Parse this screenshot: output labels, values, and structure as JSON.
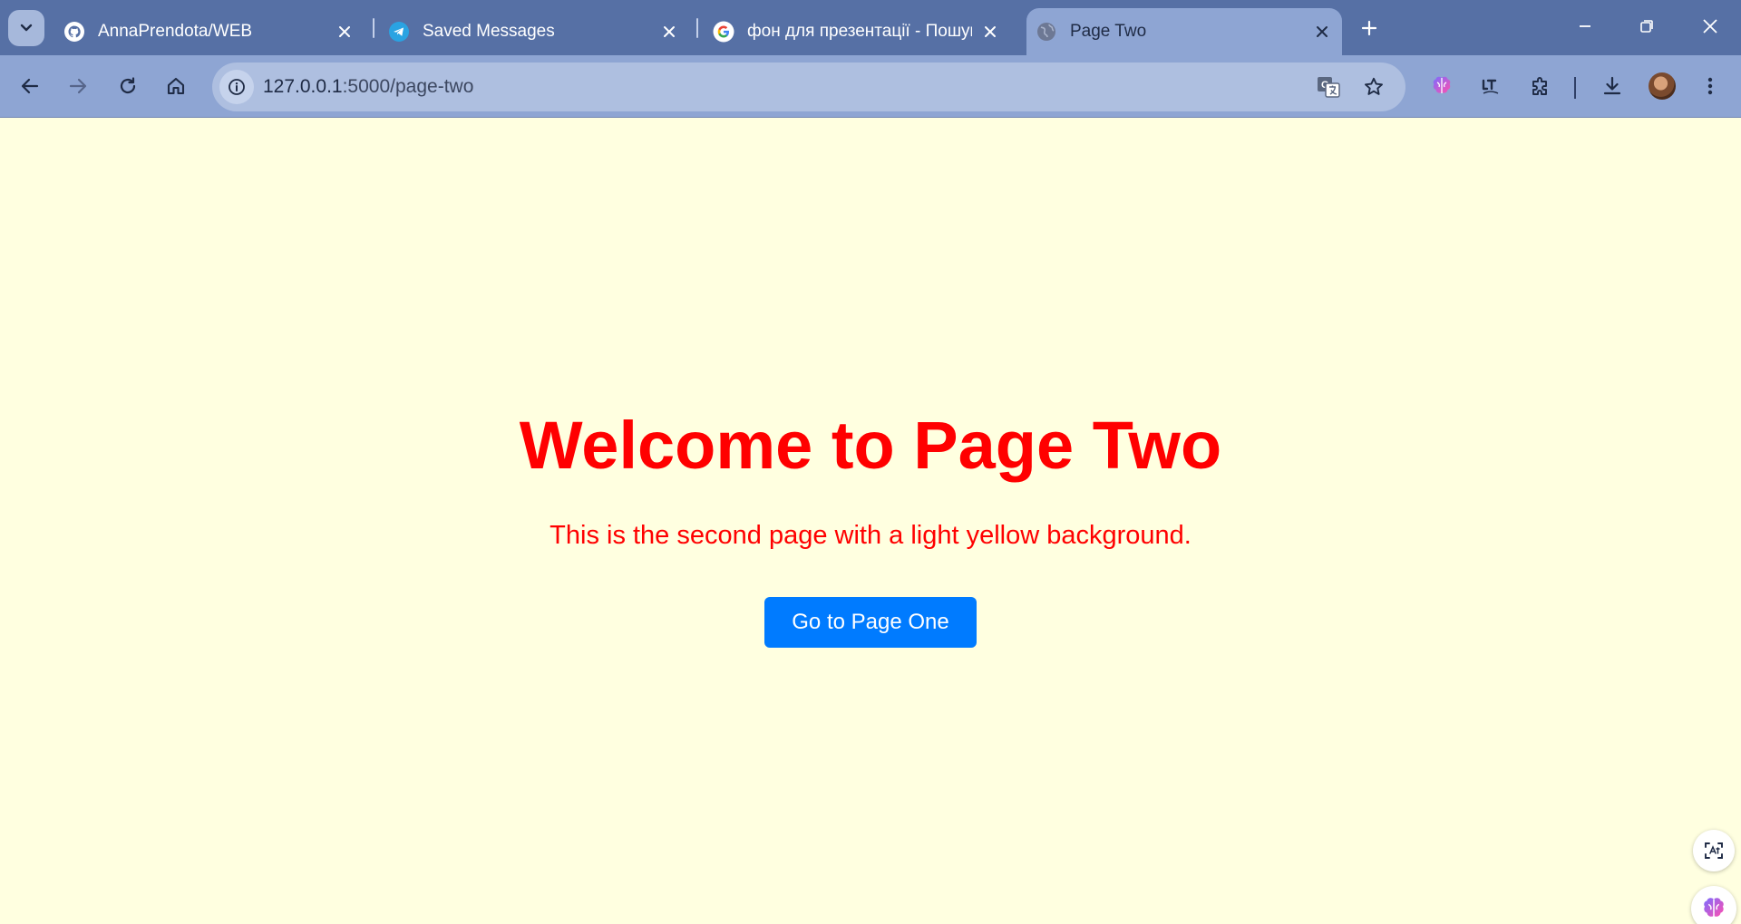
{
  "browser": {
    "tabs": [
      {
        "title": "AnnaPrendota/WEB",
        "icon": "github-icon",
        "active": false
      },
      {
        "title": "Saved Messages",
        "icon": "telegram-icon",
        "active": false
      },
      {
        "title": "фон для презентації - Пошук G",
        "icon": "google-icon",
        "active": false
      },
      {
        "title": "Page Two",
        "icon": "globe-icon",
        "active": true
      }
    ],
    "address": {
      "host": "127.0.0.1",
      "path": ":5000/page-two"
    }
  },
  "page": {
    "heading": "Welcome to Page Two",
    "description": "This is the second page with a light yellow background.",
    "button_label": "Go to Page One"
  },
  "colors": {
    "background": "#ffffe0",
    "text": "#ff0000",
    "button": "#007bff",
    "chrome_frame": "#5670a5",
    "chrome_toolbar": "#8ea5d3"
  }
}
